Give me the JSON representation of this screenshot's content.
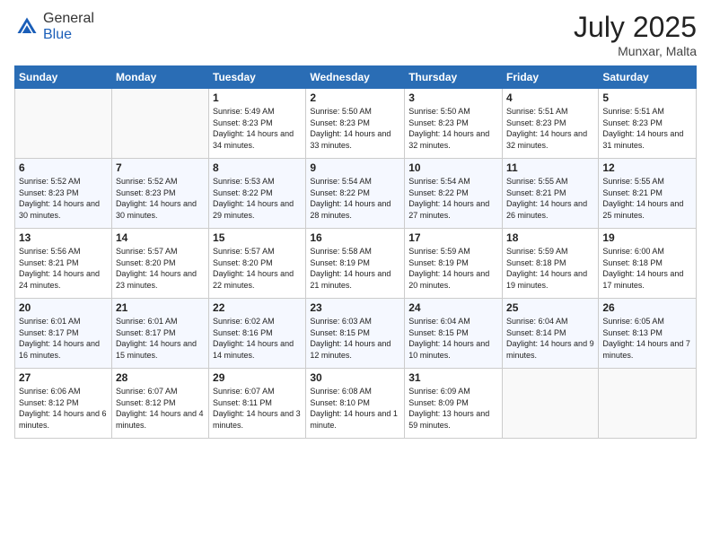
{
  "header": {
    "logo_general": "General",
    "logo_blue": "Blue",
    "month": "July 2025",
    "location": "Munxar, Malta"
  },
  "days_of_week": [
    "Sunday",
    "Monday",
    "Tuesday",
    "Wednesday",
    "Thursday",
    "Friday",
    "Saturday"
  ],
  "weeks": [
    [
      {
        "day": "",
        "empty": true
      },
      {
        "day": "",
        "empty": true
      },
      {
        "day": "1",
        "sunrise": "Sunrise: 5:49 AM",
        "sunset": "Sunset: 8:23 PM",
        "daylight": "Daylight: 14 hours and 34 minutes."
      },
      {
        "day": "2",
        "sunrise": "Sunrise: 5:50 AM",
        "sunset": "Sunset: 8:23 PM",
        "daylight": "Daylight: 14 hours and 33 minutes."
      },
      {
        "day": "3",
        "sunrise": "Sunrise: 5:50 AM",
        "sunset": "Sunset: 8:23 PM",
        "daylight": "Daylight: 14 hours and 32 minutes."
      },
      {
        "day": "4",
        "sunrise": "Sunrise: 5:51 AM",
        "sunset": "Sunset: 8:23 PM",
        "daylight": "Daylight: 14 hours and 32 minutes."
      },
      {
        "day": "5",
        "sunrise": "Sunrise: 5:51 AM",
        "sunset": "Sunset: 8:23 PM",
        "daylight": "Daylight: 14 hours and 31 minutes."
      }
    ],
    [
      {
        "day": "6",
        "sunrise": "Sunrise: 5:52 AM",
        "sunset": "Sunset: 8:23 PM",
        "daylight": "Daylight: 14 hours and 30 minutes."
      },
      {
        "day": "7",
        "sunrise": "Sunrise: 5:52 AM",
        "sunset": "Sunset: 8:23 PM",
        "daylight": "Daylight: 14 hours and 30 minutes."
      },
      {
        "day": "8",
        "sunrise": "Sunrise: 5:53 AM",
        "sunset": "Sunset: 8:22 PM",
        "daylight": "Daylight: 14 hours and 29 minutes."
      },
      {
        "day": "9",
        "sunrise": "Sunrise: 5:54 AM",
        "sunset": "Sunset: 8:22 PM",
        "daylight": "Daylight: 14 hours and 28 minutes."
      },
      {
        "day": "10",
        "sunrise": "Sunrise: 5:54 AM",
        "sunset": "Sunset: 8:22 PM",
        "daylight": "Daylight: 14 hours and 27 minutes."
      },
      {
        "day": "11",
        "sunrise": "Sunrise: 5:55 AM",
        "sunset": "Sunset: 8:21 PM",
        "daylight": "Daylight: 14 hours and 26 minutes."
      },
      {
        "day": "12",
        "sunrise": "Sunrise: 5:55 AM",
        "sunset": "Sunset: 8:21 PM",
        "daylight": "Daylight: 14 hours and 25 minutes."
      }
    ],
    [
      {
        "day": "13",
        "sunrise": "Sunrise: 5:56 AM",
        "sunset": "Sunset: 8:21 PM",
        "daylight": "Daylight: 14 hours and 24 minutes."
      },
      {
        "day": "14",
        "sunrise": "Sunrise: 5:57 AM",
        "sunset": "Sunset: 8:20 PM",
        "daylight": "Daylight: 14 hours and 23 minutes."
      },
      {
        "day": "15",
        "sunrise": "Sunrise: 5:57 AM",
        "sunset": "Sunset: 8:20 PM",
        "daylight": "Daylight: 14 hours and 22 minutes."
      },
      {
        "day": "16",
        "sunrise": "Sunrise: 5:58 AM",
        "sunset": "Sunset: 8:19 PM",
        "daylight": "Daylight: 14 hours and 21 minutes."
      },
      {
        "day": "17",
        "sunrise": "Sunrise: 5:59 AM",
        "sunset": "Sunset: 8:19 PM",
        "daylight": "Daylight: 14 hours and 20 minutes."
      },
      {
        "day": "18",
        "sunrise": "Sunrise: 5:59 AM",
        "sunset": "Sunset: 8:18 PM",
        "daylight": "Daylight: 14 hours and 19 minutes."
      },
      {
        "day": "19",
        "sunrise": "Sunrise: 6:00 AM",
        "sunset": "Sunset: 8:18 PM",
        "daylight": "Daylight: 14 hours and 17 minutes."
      }
    ],
    [
      {
        "day": "20",
        "sunrise": "Sunrise: 6:01 AM",
        "sunset": "Sunset: 8:17 PM",
        "daylight": "Daylight: 14 hours and 16 minutes."
      },
      {
        "day": "21",
        "sunrise": "Sunrise: 6:01 AM",
        "sunset": "Sunset: 8:17 PM",
        "daylight": "Daylight: 14 hours and 15 minutes."
      },
      {
        "day": "22",
        "sunrise": "Sunrise: 6:02 AM",
        "sunset": "Sunset: 8:16 PM",
        "daylight": "Daylight: 14 hours and 14 minutes."
      },
      {
        "day": "23",
        "sunrise": "Sunrise: 6:03 AM",
        "sunset": "Sunset: 8:15 PM",
        "daylight": "Daylight: 14 hours and 12 minutes."
      },
      {
        "day": "24",
        "sunrise": "Sunrise: 6:04 AM",
        "sunset": "Sunset: 8:15 PM",
        "daylight": "Daylight: 14 hours and 10 minutes."
      },
      {
        "day": "25",
        "sunrise": "Sunrise: 6:04 AM",
        "sunset": "Sunset: 8:14 PM",
        "daylight": "Daylight: 14 hours and 9 minutes."
      },
      {
        "day": "26",
        "sunrise": "Sunrise: 6:05 AM",
        "sunset": "Sunset: 8:13 PM",
        "daylight": "Daylight: 14 hours and 7 minutes."
      }
    ],
    [
      {
        "day": "27",
        "sunrise": "Sunrise: 6:06 AM",
        "sunset": "Sunset: 8:12 PM",
        "daylight": "Daylight: 14 hours and 6 minutes."
      },
      {
        "day": "28",
        "sunrise": "Sunrise: 6:07 AM",
        "sunset": "Sunset: 8:12 PM",
        "daylight": "Daylight: 14 hours and 4 minutes."
      },
      {
        "day": "29",
        "sunrise": "Sunrise: 6:07 AM",
        "sunset": "Sunset: 8:11 PM",
        "daylight": "Daylight: 14 hours and 3 minutes."
      },
      {
        "day": "30",
        "sunrise": "Sunrise: 6:08 AM",
        "sunset": "Sunset: 8:10 PM",
        "daylight": "Daylight: 14 hours and 1 minute."
      },
      {
        "day": "31",
        "sunrise": "Sunrise: 6:09 AM",
        "sunset": "Sunset: 8:09 PM",
        "daylight": "Daylight: 13 hours and 59 minutes."
      },
      {
        "day": "",
        "empty": true
      },
      {
        "day": "",
        "empty": true
      }
    ]
  ]
}
